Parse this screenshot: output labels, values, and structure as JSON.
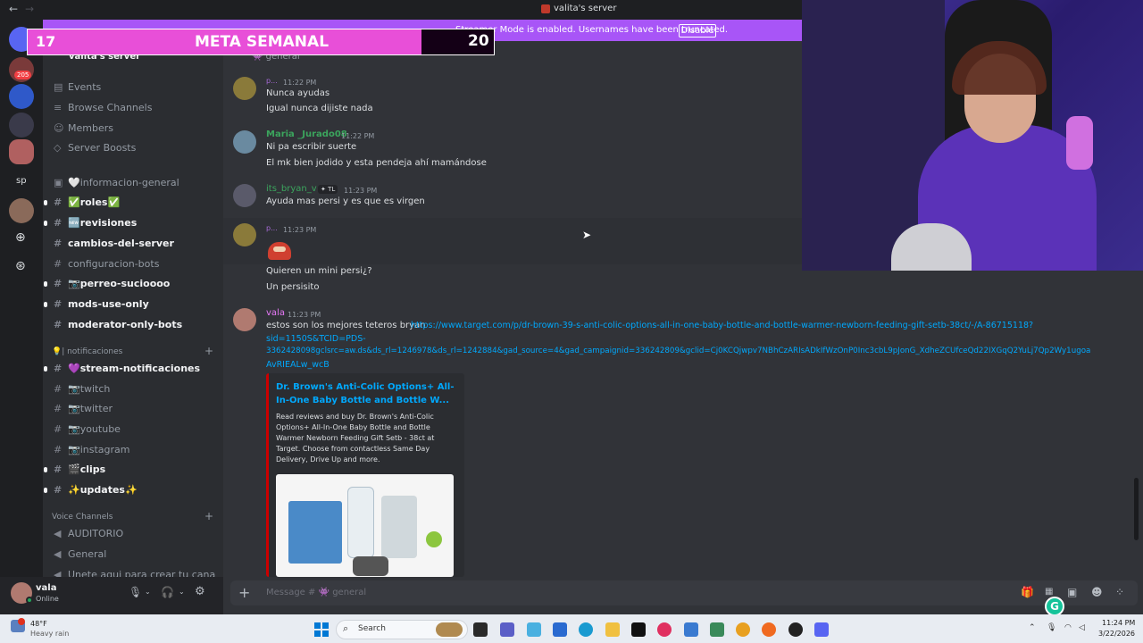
{
  "window": {
    "title": "valita's server"
  },
  "streamer_bar": {
    "text": "Streamer Mode is enabled. Usernames have been truncated.",
    "disable_label": "Disable"
  },
  "overlay": {
    "left_count": "17",
    "title": "META SEMANAL",
    "right_count": "20"
  },
  "guilds": {
    "badge": "205",
    "sp_label": "sp"
  },
  "server": {
    "name": "valita's server"
  },
  "channel_actions": [
    "Events",
    "Browse Channels",
    "Members",
    "Server Boosts"
  ],
  "channels": [
    {
      "label": "🤍informacion-general"
    },
    {
      "label": "✅roles✅"
    },
    {
      "label": "🆕revisiones"
    },
    {
      "label": "cambios-del-server"
    },
    {
      "label": "configuracion-bots"
    },
    {
      "label": "📷perreo-sucioooo"
    },
    {
      "label": "mods-use-only"
    },
    {
      "label": "moderator-only-bots"
    }
  ],
  "categories": {
    "notifications": "💡| notificaciones",
    "voice": "Voice Channels"
  },
  "notify_channels": [
    {
      "label": "💜stream-notificaciones"
    },
    {
      "label": "📷twitch"
    },
    {
      "label": "📷twitter"
    },
    {
      "label": "📷youtube"
    },
    {
      "label": "📷instagram"
    },
    {
      "label": "🎬clips"
    },
    {
      "label": "✨updates✨"
    }
  ],
  "voice_channels": [
    "AUDITORIO",
    "General",
    "Unete aqui para crear tu cana"
  ],
  "chat_header": {
    "channel": "general"
  },
  "messages": [
    {
      "author": "p...",
      "time": "11:22 PM",
      "lines": [
        "Nunca ayudas",
        "Igual nunca dijiste nada"
      ]
    },
    {
      "author": "Maria _Jurado08",
      "time": "11:22 PM",
      "lines": [
        "Ni pa escribir suerte",
        "El mk bien jodido y esta pendeja ahí mamándose"
      ]
    },
    {
      "author": "its_bryan_v",
      "tag": "TL",
      "time": "11:23 PM",
      "lines": [
        "Ayuda mas persi y es que es virgen"
      ]
    },
    {
      "author": "p...",
      "time": "11:23 PM",
      "lines": [
        "Quieren un mini persi¿?",
        "Un persisito"
      ]
    },
    {
      "author": "vala",
      "time": "11:23 PM",
      "text": "estos son los mejores teteros bryan",
      "link_lines": [
        "https://www.target.com/p/dr-brown-39-s-anti-colic-options-all-in-one-baby-bottle-and-bottle-warmer-newborn-feeding-gift-setb-38ct/-/A-86715118?",
        "sid=1150S&TCID=PDS-",
        "3362428098gclsrc=aw.ds&ds_rl=1246978&ds_rl=1242884&gad_source=4&gad_campaignid=336242809&gclid=Cj0KCQjwpv7NBhCzARIsADkIfWzOnP0Inc3cbL9pJonG_XdheZCUfceQd22IXGqQ2YuLj7Qp2Wy1ugoa",
        "AvRIEALw_wcB"
      ]
    }
  ],
  "embed": {
    "title": "Dr. Brown's Anti-Colic Options+ All-In-One Baby Bottle and Bottle W...",
    "description": "Read reviews and buy Dr. Brown's Anti-Colic Options+ All-In-One Baby Bottle and Bottle Warmer Newborn Feeding Gift Setb - 38ct at Target. Choose from contactless Same Day Delivery, Drive Up and more."
  },
  "composer": {
    "placeholder": "Message # 👾 general"
  },
  "user": {
    "name": "vala",
    "status": "Online"
  },
  "taskbar": {
    "weather_temp": "48°F",
    "weather_desc": "Heavy rain",
    "search_label": "Search",
    "time": "11:24 PM",
    "date": "3/22/2026"
  }
}
